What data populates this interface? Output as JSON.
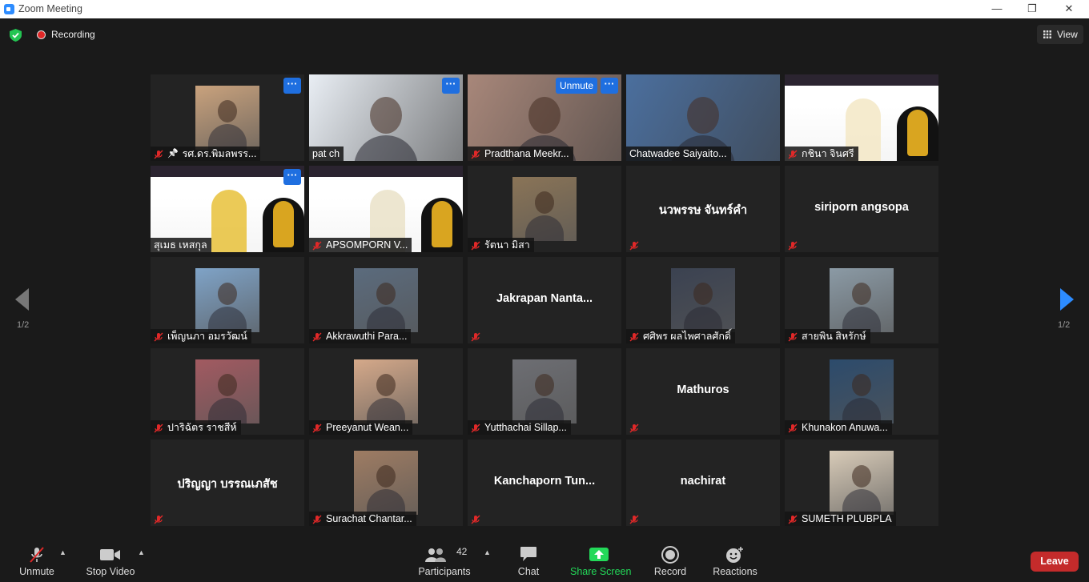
{
  "window": {
    "title": "Zoom Meeting",
    "minimize_label": "—",
    "restore_label": "❐",
    "close_label": "✕"
  },
  "top": {
    "recording_label": "Recording",
    "view_label": "View"
  },
  "tiles": [
    {
      "name": "รศ.ดร.พิมลพรร...",
      "big": "",
      "unmute": "",
      "more": true,
      "pin": true,
      "muted": true,
      "kind": "photo",
      "color": "#c9a27d"
    },
    {
      "name": "pat ch",
      "big": "",
      "unmute": "",
      "more": true,
      "pin": false,
      "muted": false,
      "kind": "video",
      "color": "#e9eef4"
    },
    {
      "name": "Pradthana Meekr...",
      "big": "",
      "unmute": "Unmute",
      "more": true,
      "pin": false,
      "muted": true,
      "kind": "video",
      "color": "#a8877a"
    },
    {
      "name": "Chatwadee Saiyaito...",
      "big": "",
      "unmute": "",
      "more": false,
      "pin": false,
      "muted": false,
      "kind": "video",
      "color": "#4b6f9e"
    },
    {
      "name": "กชินา จินศรี",
      "big": "",
      "unmute": "",
      "more": false,
      "pin": false,
      "muted": true,
      "kind": "slide",
      "color": "#f3e7c5"
    },
    {
      "name": "สุเมธ เหสกุล",
      "big": "",
      "unmute": "",
      "more": true,
      "pin": false,
      "muted": false,
      "kind": "slide",
      "color": "#e8c13a",
      "active": true
    },
    {
      "name": "APSOMPORN V...",
      "big": "",
      "unmute": "",
      "more": false,
      "pin": false,
      "muted": true,
      "kind": "slide",
      "color": "#eae2c8"
    },
    {
      "name": "รัตนา มิสา",
      "big": "",
      "unmute": "",
      "more": false,
      "pin": false,
      "muted": true,
      "kind": "photo",
      "color": "#8a7457"
    },
    {
      "name": "",
      "big": "นวพรรษ จันทร์คำ",
      "unmute": "",
      "more": false,
      "pin": false,
      "muted": true,
      "kind": "none",
      "color": ""
    },
    {
      "name": "",
      "big": "siriporn angsopa",
      "unmute": "",
      "more": false,
      "pin": false,
      "muted": true,
      "kind": "none",
      "color": ""
    },
    {
      "name": "เพ็ญนภา อมรวัฒน์",
      "big": "",
      "unmute": "",
      "more": false,
      "pin": false,
      "muted": true,
      "kind": "photo",
      "color": "#7fa3c7"
    },
    {
      "name": "Akkrawuthi Para...",
      "big": "",
      "unmute": "",
      "more": false,
      "pin": false,
      "muted": true,
      "kind": "photo",
      "color": "#5b6b7d"
    },
    {
      "name": "",
      "big": "Jakrapan  Nanta...",
      "unmute": "",
      "more": false,
      "pin": false,
      "muted": true,
      "kind": "none",
      "color": ""
    },
    {
      "name": "ศศิพร ผลไพศาลศักดิ์",
      "big": "",
      "unmute": "",
      "more": false,
      "pin": false,
      "muted": true,
      "kind": "photo",
      "color": "#3b4251"
    },
    {
      "name": "สายพิน สิหรักษ์",
      "big": "",
      "unmute": "",
      "more": false,
      "pin": false,
      "muted": true,
      "kind": "photo",
      "color": "#8b9aa5"
    },
    {
      "name": "ปาริฉัตร ราชสีห์",
      "big": "",
      "unmute": "",
      "more": false,
      "pin": false,
      "muted": true,
      "kind": "photo",
      "color": "#a25a61"
    },
    {
      "name": "Preeyanut Wean...",
      "big": "",
      "unmute": "",
      "more": false,
      "pin": false,
      "muted": true,
      "kind": "photo",
      "color": "#d5a98a"
    },
    {
      "name": "Yutthachai Sillap...",
      "big": "",
      "unmute": "",
      "more": false,
      "pin": false,
      "muted": true,
      "kind": "photo",
      "color": "#6d6e73"
    },
    {
      "name": "",
      "big": "Mathuros",
      "unmute": "",
      "more": false,
      "pin": false,
      "muted": true,
      "kind": "none",
      "color": ""
    },
    {
      "name": "Khunakon Anuwa...",
      "big": "",
      "unmute": "",
      "more": false,
      "pin": false,
      "muted": true,
      "kind": "photo",
      "color": "#2c4b6c"
    },
    {
      "name": "",
      "big": "ปริญญา บรรณเภสัช",
      "unmute": "",
      "more": false,
      "pin": false,
      "muted": true,
      "kind": "none",
      "color": ""
    },
    {
      "name": "Surachat Chantar...",
      "big": "",
      "unmute": "",
      "more": false,
      "pin": false,
      "muted": true,
      "kind": "photo",
      "color": "#9e7c63"
    },
    {
      "name": "",
      "big": "Kanchaporn  Tun...",
      "unmute": "",
      "more": false,
      "pin": false,
      "muted": true,
      "kind": "none",
      "color": ""
    },
    {
      "name": "",
      "big": "nachirat",
      "unmute": "",
      "more": false,
      "pin": false,
      "muted": true,
      "kind": "none",
      "color": ""
    },
    {
      "name": "SUMETH PLUBPLA",
      "big": "",
      "unmute": "",
      "more": false,
      "pin": false,
      "muted": true,
      "kind": "photo",
      "color": "#d8cbb8"
    }
  ],
  "pages": {
    "left": "1/2",
    "right": "1/2"
  },
  "toolbar": {
    "unmute": "Unmute",
    "stop_video": "Stop Video",
    "participants": "Participants",
    "participants_count": "42",
    "chat": "Chat",
    "share_screen": "Share Screen",
    "record": "Record",
    "reactions": "Reactions",
    "leave": "Leave"
  },
  "colors": {
    "accent": "#2d8cff",
    "share": "#23d959",
    "leave": "#c42b2b",
    "active_speaker": "#b9e04a"
  }
}
